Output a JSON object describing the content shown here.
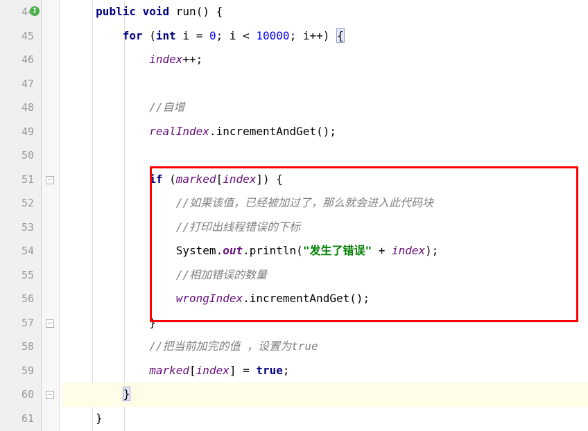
{
  "lines": {
    "start": 44,
    "end": 61
  },
  "code": {
    "l44": {
      "kw1": "public",
      "kw2": "void",
      "method": "run",
      "rest": "() {"
    },
    "l45": {
      "kw1": "for",
      "p1": " (",
      "kw2": "int",
      "var": " i ",
      "p2": "= ",
      "num1": "0",
      "p3": "; i < ",
      "num2": "10000",
      "p4": "; i++) ",
      "brace": "{"
    },
    "l46": {
      "ident": "index",
      "rest": "++;"
    },
    "l48": {
      "comment": "//自增"
    },
    "l49": {
      "ident": "realIndex",
      "method": ".incrementAndGet();"
    },
    "l51": {
      "kw": "if",
      "p1": " (",
      "ident1": "marked",
      "p2": "[",
      "ident2": "index",
      "p3": "]) {"
    },
    "l52": {
      "comment": "//如果该值，已经被加过了，那么就会进入此代码块"
    },
    "l53": {
      "comment": "//打印出线程错误的下标"
    },
    "l54": {
      "p1": "System.",
      "out": "out",
      "p2": ".println(",
      "str": "\"发生了错误\"",
      "p3": " + ",
      "ident": "index",
      "p4": ");"
    },
    "l55": {
      "comment": "//相加错误的数量"
    },
    "l56": {
      "ident": "wrongIndex",
      "method": ".incrementAndGet();"
    },
    "l57": {
      "brace": "}"
    },
    "l58": {
      "comment": "//把当前加完的值 ，设置为true"
    },
    "l59": {
      "ident1": "marked",
      "p1": "[",
      "ident2": "index",
      "p2": "] = ",
      "kw": "true",
      "p3": ";"
    },
    "l60": {
      "brace": "}"
    },
    "l61": {
      "brace": "}"
    }
  },
  "lineNumbers": [
    "44",
    "45",
    "46",
    "47",
    "48",
    "49",
    "50",
    "51",
    "52",
    "53",
    "54",
    "55",
    "56",
    "57",
    "58",
    "59",
    "60",
    "61"
  ]
}
